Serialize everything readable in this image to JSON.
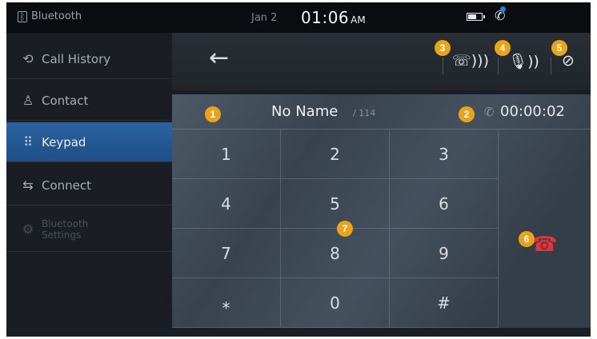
{
  "statusbar": {
    "source": "Bluetooth",
    "date": "Jan 2",
    "time": "01:06",
    "ampm": "AM",
    "battery_icon": "battery-icon",
    "phone_icon": "phone-icon"
  },
  "sidebar": {
    "items": [
      {
        "label": "Call History",
        "icon": "history-icon"
      },
      {
        "label": "Contact",
        "icon": "contact-icon"
      },
      {
        "label": "Keypad",
        "icon": "keypad-icon"
      },
      {
        "label": "Connect",
        "icon": "connect-icon"
      },
      {
        "label_line1": "Bluetooth",
        "label_line2": "Settings",
        "icon": "gear-icon"
      }
    ]
  },
  "toolbar": {
    "back_icon": "back-arrow-icon",
    "voice_to_phone_icon": "handset-audio-icon",
    "mic_icon": "microphone-icon",
    "mute_icon": "mute-icon"
  },
  "call": {
    "name": "No Name",
    "number": "/ 114",
    "duration": "00:00:02"
  },
  "keypad": {
    "keys": [
      "1",
      "2",
      "3",
      "4",
      "5",
      "6",
      "7",
      "8",
      "9",
      "⁎",
      "0",
      "#"
    ]
  },
  "end_call_icon": "end-call-icon",
  "markers": [
    "1",
    "2",
    "3",
    "4",
    "5",
    "6",
    "7"
  ],
  "colors": {
    "accent_blue": "#2b63a0",
    "end_call_red": "#e2343a",
    "marker_orange": "#e9a41a"
  }
}
